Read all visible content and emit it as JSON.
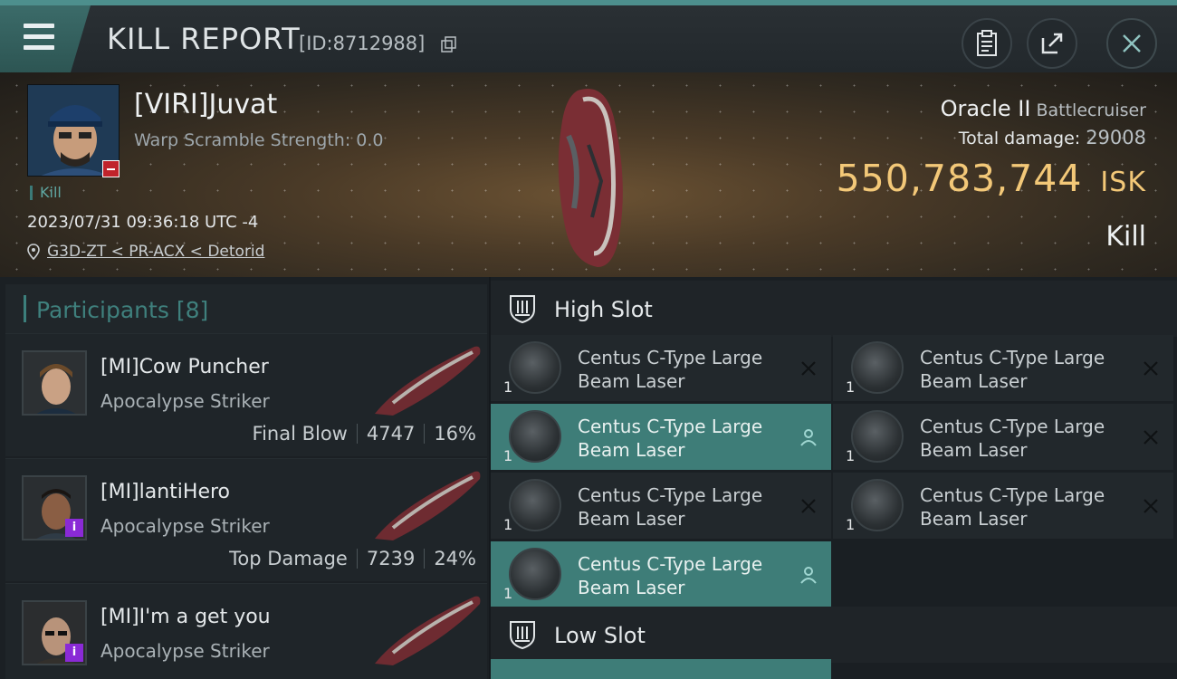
{
  "header": {
    "title": "KILL REPORT",
    "id_text": "[ID:8712988]"
  },
  "victim": {
    "name": "[VIRI]Juvat",
    "warp_scramble": "Warp Scramble Strength: 0.0",
    "tag": "Kill",
    "datetime": "2023/07/31 09:36:18 UTC -4",
    "location": "G3D-ZT < PR-ACX < Detorid",
    "ship_name": "Oracle II",
    "ship_class": "Battlecruiser",
    "total_damage_label": "Total damage:",
    "total_damage_value": "29008",
    "isk_value": "550,783,744",
    "isk_unit": "ISK",
    "result": "Kill"
  },
  "participants": {
    "title": "Participants",
    "count": "[8]",
    "items": [
      {
        "name": "[MI]Cow Puncher",
        "ship": "Apocalypse Striker",
        "label": "Final Blow",
        "damage": "4747",
        "percent": "16%"
      },
      {
        "name": "[MI]lantiHero",
        "ship": "Apocalypse Striker",
        "label": "Top Damage",
        "damage": "7239",
        "percent": "24%"
      },
      {
        "name": "[MI]I'm a get you",
        "ship": "Apocalypse Striker"
      }
    ]
  },
  "slots": {
    "high": {
      "title": "High Slot",
      "modules": [
        {
          "line1": "Centus C-Type Large",
          "line2": "Beam Laser",
          "qty": "1",
          "state": "destroyed"
        },
        {
          "line1": "Centus C-Type Large",
          "line2": "Beam Laser",
          "qty": "1",
          "state": "destroyed"
        },
        {
          "line1": "Centus C-Type Large",
          "line2": "Beam Laser",
          "qty": "1",
          "state": "dropped"
        },
        {
          "line1": "Centus C-Type Large",
          "line2": "Beam Laser",
          "qty": "1",
          "state": "destroyed"
        },
        {
          "line1": "Centus C-Type Large",
          "line2": "Beam Laser",
          "qty": "1",
          "state": "destroyed"
        },
        {
          "line1": "Centus C-Type Large",
          "line2": "Beam Laser",
          "qty": "1",
          "state": "destroyed"
        },
        {
          "line1": "Centus C-Type Large",
          "line2": "Beam Laser",
          "qty": "1",
          "state": "dropped"
        }
      ]
    },
    "low": {
      "title": "Low Slot"
    }
  },
  "colors": {
    "accent": "#3e7d78",
    "isk": "#f3c878",
    "header_stripe": "#4d8f8d"
  }
}
